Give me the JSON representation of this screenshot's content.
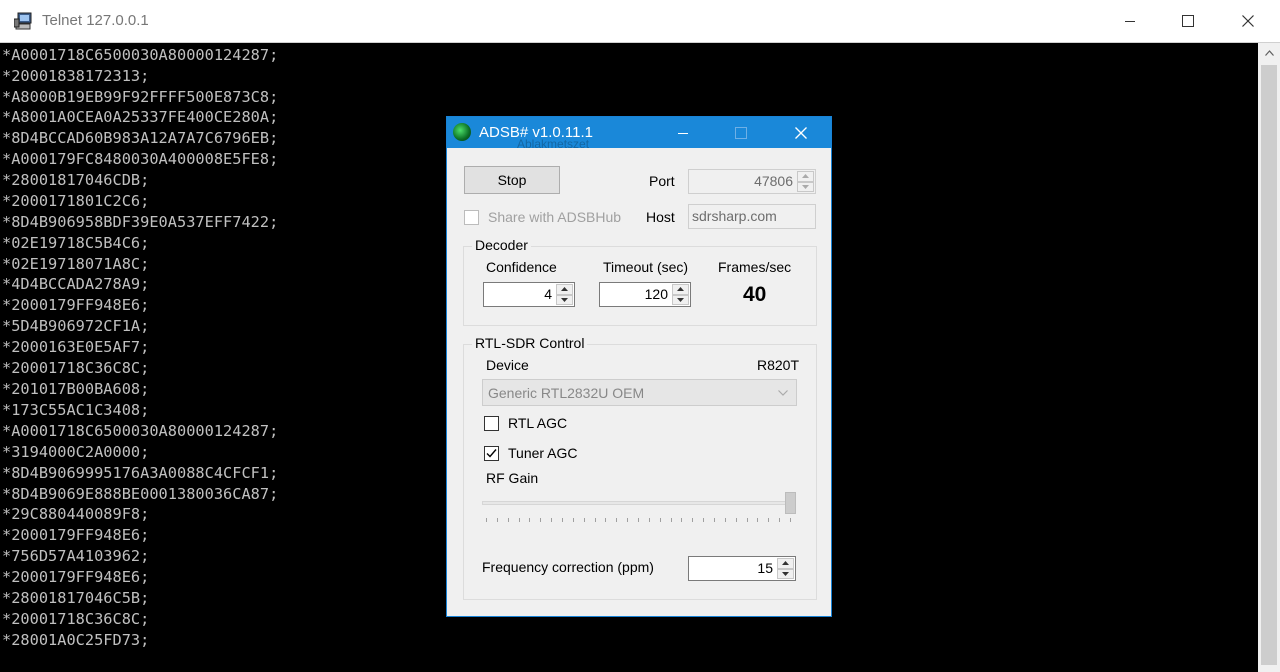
{
  "telnet": {
    "title": "Telnet 127.0.0.1",
    "lines": [
      "*A0001718C6500030A80000124287;",
      "*20001838172313;",
      "*A8000B19EB99F92FFFF500E873C8;",
      "*A8001A0CEA0A25337FE400CE280A;",
      "*8D4BCCAD60B983A12A7A7C6796EB;",
      "*A000179FC8480030A400008E5FE8;",
      "*28001817046CDB;",
      "*2000171801C2C6;",
      "*8D4B906958BDF39E0A537EFF7422;",
      "*02E19718C5B4C6;",
      "*02E19718071A8C;",
      "*4D4BCCADA278A9;",
      "*2000179FF948E6;",
      "*5D4B906972CF1A;",
      "*2000163E0E5AF7;",
      "*20001718C36C8C;",
      "*201017B00BA608;",
      "*173C55AC1C3408;",
      "*A0001718C6500030A80000124287;",
      "*3194000C2A0000;",
      "*8D4B9069995176A3A0088C4CFCF1;",
      "*8D4B9069E888BE0001380036CA87;",
      "*29C880440089F8;",
      "*2000179FF948E6;",
      "*756D57A4103962;",
      "*2000179FF948E6;",
      "*28001817046C5B;",
      "*20001718C36C8C;",
      "*28001A0C25FD73;"
    ]
  },
  "adsb": {
    "title": "ADSB# v1.0.11.1",
    "ghost_text": "Ablakmetszet",
    "stop_label": "Stop",
    "port_label": "Port",
    "port_value": "47806",
    "share_label": "Share with ADSBHub",
    "share_checked": false,
    "host_label": "Host",
    "host_value": "sdrsharp.com",
    "decoder": {
      "title": "Decoder",
      "confidence_label": "Confidence",
      "confidence_value": "4",
      "timeout_label": "Timeout (sec)",
      "timeout_value": "120",
      "fps_label": "Frames/sec",
      "fps_value": "40"
    },
    "rtl": {
      "title": "RTL-SDR Control",
      "device_label": "Device",
      "tuner_name": "R820T",
      "device_selected": "Generic RTL2832U OEM",
      "rtl_agc_label": "RTL AGC",
      "rtl_agc_checked": false,
      "tuner_agc_label": "Tuner AGC",
      "tuner_agc_checked": true,
      "rf_gain_label": "RF Gain",
      "rf_gain_level": 1.0,
      "freq_corr_label": "Frequency correction (ppm)",
      "freq_corr_value": "15"
    }
  }
}
